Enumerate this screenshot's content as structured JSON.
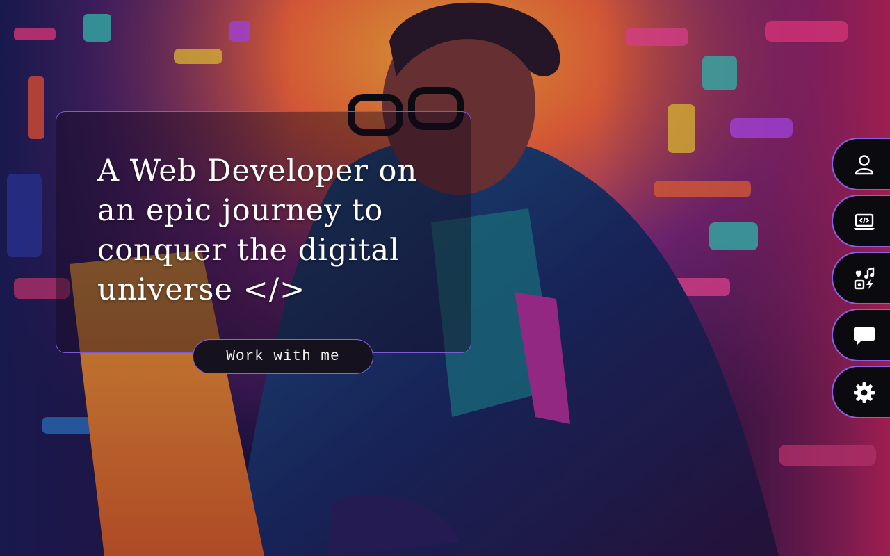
{
  "hero": {
    "title": "A Web Developer on an epic journey to conquer the digital universe </>",
    "cta_label": "Work with me"
  },
  "side_nav": {
    "items": [
      {
        "name": "about",
        "icon": "user-icon"
      },
      {
        "name": "projects",
        "icon": "laptop-code-icon"
      },
      {
        "name": "hobbies",
        "icon": "hobbies-icon"
      },
      {
        "name": "contact",
        "icon": "chat-bubble-icon"
      },
      {
        "name": "settings",
        "icon": "gear-icon"
      }
    ]
  },
  "colors": {
    "accent_border": "#8b5fe0",
    "button_bg": "#16121d",
    "nav_bg": "#0b0b0f",
    "text": "#ffffff"
  }
}
